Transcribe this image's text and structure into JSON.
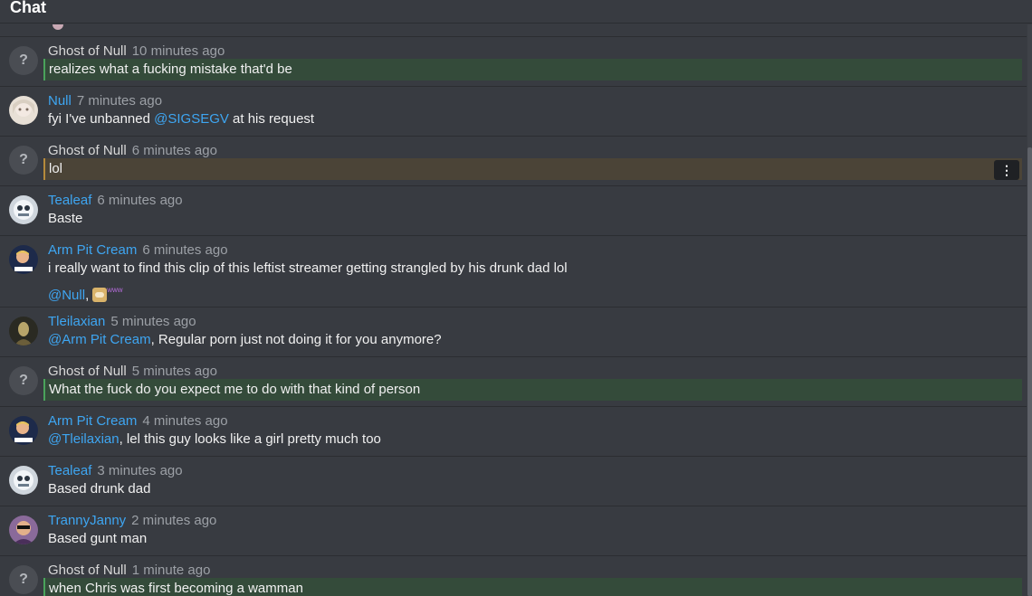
{
  "header": {
    "title": "Chat"
  },
  "chat": {
    "messages": [
      {
        "author": "Ghost of Null",
        "time": "10 minutes ago",
        "text": "realizes what a fucking mistake that'd be",
        "avatar": "question-avatar",
        "style": "green"
      },
      {
        "author": "Null",
        "time": "7 minutes ago",
        "text_before": "fyi I've unbanned ",
        "mention": "@SIGSEGV",
        "text_after": " at his request",
        "avatar": "anime-avatar"
      },
      {
        "author": "Ghost of Null",
        "time": "6 minutes ago",
        "text": "lol",
        "avatar": "question-avatar",
        "style": "amber",
        "menu_icon": "⋮"
      },
      {
        "author": "Tealeaf",
        "time": "6 minutes ago",
        "text": "Baste",
        "avatar": "robot-avatar"
      },
      {
        "author": "Arm Pit Cream",
        "time": "6 minutes ago",
        "text": "i really want to find this clip of this leftist streamer getting strangled by his drunk dad lol",
        "mention2": "@Null",
        "text2": ",",
        "emoji_tag": "www",
        "avatar": "daddy-avatar"
      },
      {
        "author": "Tleilaxian",
        "time": "5 minutes ago",
        "mention": "@Arm Pit Cream",
        "text_after": ", Regular porn just not doing it for you anymore?",
        "avatar": "dark-figure-avatar"
      },
      {
        "author": "Ghost of Null",
        "time": "5 minutes ago",
        "text": "What the fuck do you expect me to do with that kind of person",
        "avatar": "question-avatar",
        "style": "green"
      },
      {
        "author": "Arm Pit Cream",
        "time": "4 minutes ago",
        "mention": "@Tleilaxian",
        "text_after": ", lel this guy looks like a girl pretty much too",
        "avatar": "daddy-avatar"
      },
      {
        "author": "Tealeaf",
        "time": "3 minutes ago",
        "text": "Based drunk dad",
        "avatar": "robot-avatar"
      },
      {
        "author": "TrannyJanny",
        "time": "2 minutes ago",
        "text": "Based gunt man",
        "avatar": "sunglasses-avatar"
      },
      {
        "author": "Ghost of Null",
        "time": "1 minute ago",
        "text": "when Chris was first becoming a wamman",
        "avatar": "question-avatar",
        "style": "green"
      }
    ],
    "unknown_avatar_glyph": "?"
  }
}
